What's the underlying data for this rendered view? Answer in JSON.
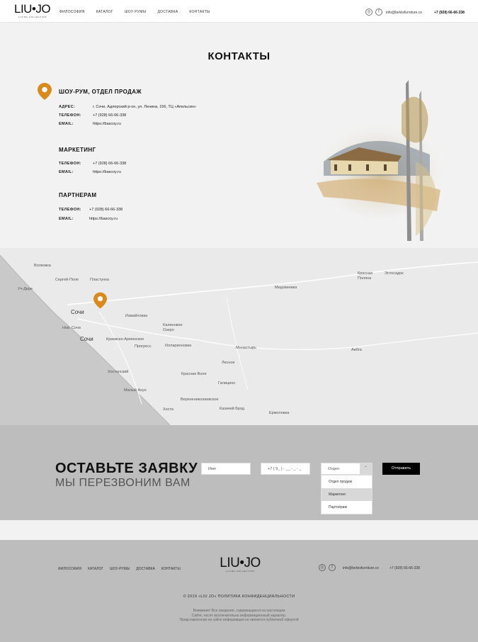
{
  "header": {
    "logo": "LIU•JO",
    "logo_sub": "LIVING COLLECTION",
    "nav": [
      "ФИЛОСОФИЯ",
      "КАТАЛОГ",
      "ШОУ-РУМЫ",
      "ДОСТАВКА",
      "КОНТАКТЫ"
    ],
    "email": "info@belvisfurniture.co",
    "phone": "+7 (928) 66-66-338"
  },
  "page_title": "КОНТАКТЫ",
  "sections": {
    "showroom": {
      "title": "ШОУ-РУМ, ОТДЕЛ ПРОДАЖ",
      "address_label": "АДРЕС:",
      "address": "г. Сочи, Адлерский р-он, ул.  Ленина, 156, ТЦ «Апельсин»",
      "phone_label": "ТЕЛЕФОН:",
      "phone": "+7 (928) 66-66-338",
      "email_label": "EMAIL:",
      "email": "https://bascoy.ru"
    },
    "marketing": {
      "title": "МАРКЕТИНГ",
      "phone_label": "ТЕЛЕФОН:",
      "phone": "+7 (928) 66-66-338",
      "email_label": "EMAIL:",
      "email": "https://bascoy.ru"
    },
    "partners": {
      "title": "ПАРТНЕРАМ",
      "phone_label": "ТЕЛЕФОН:",
      "phone": "+7 (928) 66-66-338",
      "email_label": "EMAIL:",
      "email": "https://bascoy.ru"
    }
  },
  "map": {
    "labels": [
      "Волковка",
      "Сергей-Поле",
      "Пластунка",
      "Уч-Дере",
      "Сочи",
      "Нов. Сочи",
      "Сочи",
      "Измайловка",
      "Калиновое Озеро",
      "Краевско-Армянское",
      "Прогресс",
      "Илларионовка",
      "Монастырь",
      "Лесное",
      "Хостинский",
      "Красная Воля",
      "Галицино",
      "Малый Ахун",
      "Верхнениколаевское",
      "Хоста",
      "Казачий Брод",
      "Ермоловка",
      "Медовеевка",
      "Красная Поляна",
      "Эстосадок",
      "Аибга"
    ]
  },
  "form": {
    "title": "ОСТАВЬТЕ ЗАЯВКУ",
    "subtitle": "МЫ ПЕРЕЗВОНИМ ВАМ",
    "name_placeholder": "Имя",
    "phone_placeholder": "+7 ( 9_ ) - __ - _ - _",
    "select_value": "Отдел",
    "options": [
      "Отдел продаж",
      "Маркетинг",
      "Партнёрам"
    ],
    "submit": "Отправить"
  },
  "footer": {
    "nav": [
      "ФИЛОСОФИЯ",
      "КАТАЛОГ",
      "ШОУ-РУМЫ",
      "ДОСТАВКА",
      "КОНТАКТЫ"
    ],
    "logo": "LIU•JO",
    "logo_sub": "LIVING COLLECTION",
    "email": "info@belvisfurniture.co",
    "phone": "+7 (928) 66-66-338",
    "copyright": "© 2019 «LIU JO» ПОЛИТИКА КОНФИДЕНЦИАЛЬНОСТИ",
    "disclaimer": [
      "Внимание! Все сведения, содержащиеся на настоящем",
      "Сайте, носят исключительно информационный характер.",
      "Представленная на сайте информация не является публичной офертой"
    ]
  },
  "colors": {
    "accent": "#d98a1d",
    "dark": "#000000",
    "form_bg": "#bdbdbd"
  }
}
